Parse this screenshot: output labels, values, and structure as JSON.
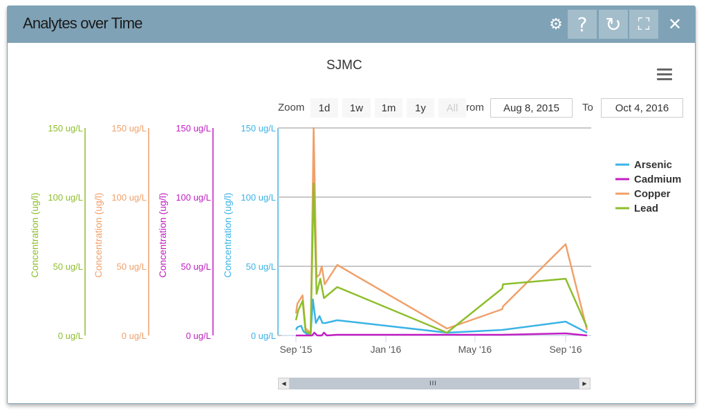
{
  "window": {
    "title": "Analytes over Time",
    "buttons": [
      {
        "name": "settings",
        "icon": "gear-icon",
        "glyph": "⚙"
      },
      {
        "name": "help",
        "icon": "question-icon",
        "glyph": "?"
      },
      {
        "name": "refresh",
        "icon": "refresh-icon",
        "glyph": "↻"
      },
      {
        "name": "fullscreen",
        "icon": "expand-icon",
        "glyph": "⛶"
      },
      {
        "name": "close",
        "icon": "close-icon",
        "glyph": "✕"
      }
    ]
  },
  "range_selector": {
    "zoom_label": "Zoom",
    "buttons": [
      "1d",
      "1w",
      "1m",
      "1y",
      "All"
    ],
    "from_label": "rom",
    "from_value": "Aug 8, 2015",
    "to_label": "To",
    "to_value": "Oct 4, 2016"
  },
  "scrollbar": {
    "grip": "III"
  },
  "chart_data": {
    "type": "line",
    "title": "SJMC",
    "xlabel": "",
    "x_ticks": [
      "Sep '15",
      "Jan '16",
      "May '16",
      "Sep '16"
    ],
    "x_tick_days": [
      0,
      122,
      243,
      366
    ],
    "x_range_days": [
      0,
      395
    ],
    "x_origin": "2015-09-01",
    "y_axes": [
      {
        "series": "Lead",
        "label": "Concentration (ug/l)",
        "ticks": [
          "0 ug/L",
          "50 ug/L",
          "100 ug/L",
          "150 ug/L"
        ],
        "color": "#8dbe2a"
      },
      {
        "series": "Copper",
        "label": "Concentration (ug/l)",
        "ticks": [
          "0 ug/L",
          "50 ug/L",
          "100 ug/L",
          "150 ug/L"
        ],
        "color": "#f0a06a"
      },
      {
        "series": "Cadmium",
        "label": "Concentration (ug/l)",
        "ticks": [
          "0 ug/L",
          "50 ug/L",
          "100 ug/L",
          "150 ug/L"
        ],
        "color": "#c21dc2"
      },
      {
        "series": "Arsenic",
        "label": "Concentration (ug/l)",
        "ticks": [
          "0 ug/L",
          "50 ug/L",
          "100 ug/L",
          "150 ug/L"
        ],
        "color": "#3ab3e6"
      }
    ],
    "ylim": [
      0,
      150
    ],
    "grid": true,
    "legend_position": "right",
    "series": [
      {
        "name": "Arsenic",
        "color": "#3ab3e6",
        "points": [
          [
            0,
            4
          ],
          [
            2,
            6
          ],
          [
            7,
            7
          ],
          [
            10,
            3
          ],
          [
            15,
            1
          ],
          [
            20,
            1
          ],
          [
            23,
            26
          ],
          [
            27,
            9
          ],
          [
            32,
            14
          ],
          [
            36,
            9
          ],
          [
            40,
            9
          ],
          [
            56,
            11
          ],
          [
            205,
            2
          ],
          [
            280,
            4
          ],
          [
            366,
            10
          ],
          [
            395,
            2
          ]
        ]
      },
      {
        "name": "Cadmium",
        "color": "#c21dc2",
        "points": [
          [
            0,
            0
          ],
          [
            10,
            0
          ],
          [
            22,
            0
          ],
          [
            25,
            2
          ],
          [
            29,
            0
          ],
          [
            35,
            0
          ],
          [
            38,
            2
          ],
          [
            42,
            0
          ],
          [
            56,
            0.5
          ],
          [
            205,
            0.5
          ],
          [
            280,
            0.5
          ],
          [
            366,
            1.5
          ],
          [
            395,
            0
          ]
        ]
      },
      {
        "name": "Copper",
        "color": "#f0a06a",
        "points": [
          [
            0,
            16
          ],
          [
            2,
            23
          ],
          [
            9,
            29
          ],
          [
            13,
            5
          ],
          [
            20,
            2
          ],
          [
            24,
            150
          ],
          [
            28,
            42
          ],
          [
            32,
            44
          ],
          [
            35,
            50
          ],
          [
            39,
            37
          ],
          [
            56,
            51
          ],
          [
            205,
            5
          ],
          [
            280,
            19
          ],
          [
            281,
            21
          ],
          [
            366,
            66
          ],
          [
            395,
            4
          ]
        ]
      },
      {
        "name": "Lead",
        "color": "#8dbe2a",
        "points": [
          [
            0,
            11
          ],
          [
            3,
            18
          ],
          [
            9,
            25
          ],
          [
            13,
            3
          ],
          [
            20,
            1
          ],
          [
            24,
            110
          ],
          [
            28,
            30
          ],
          [
            33,
            41
          ],
          [
            38,
            27
          ],
          [
            56,
            35
          ],
          [
            205,
            2
          ],
          [
            280,
            34
          ],
          [
            281,
            37
          ],
          [
            366,
            41
          ],
          [
            395,
            6
          ]
        ]
      }
    ]
  }
}
